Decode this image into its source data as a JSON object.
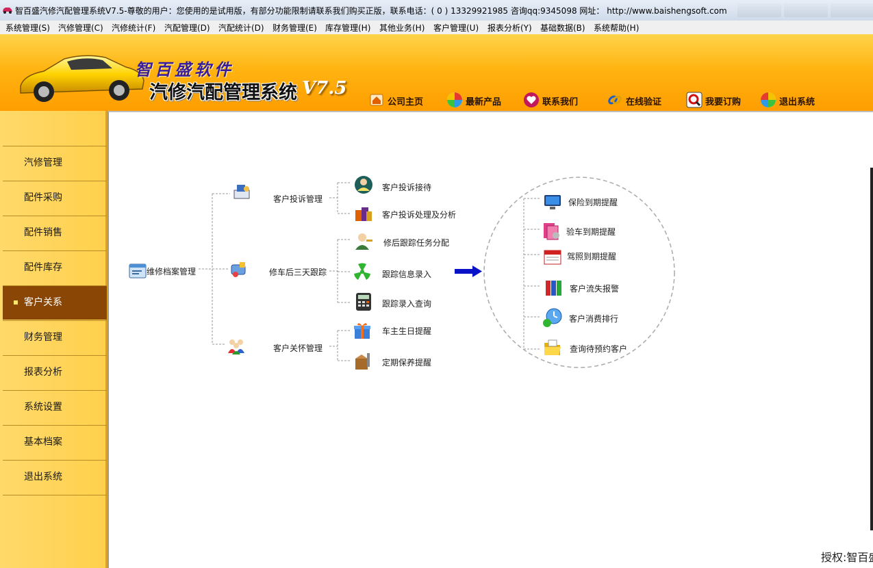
{
  "window": {
    "title": "智百盛汽修汽配管理系统V7.5-尊敬的用户：您使用的是试用版，有部分功能限制请联系我们购买正版，联系电话：( 0 ) 13329921985  咨询qq:9345098   网址： http://www.baishengsoft.com"
  },
  "menu": [
    "系统管理(S)",
    "汽修管理(C)",
    "汽修统计(F)",
    "汽配管理(D)",
    "汽配统计(D)",
    "财务管理(E)",
    "库存管理(H)",
    "其他业务(H)",
    "客户管理(U)",
    "报表分析(Y)",
    "基础数据(B)",
    "系统帮助(H)"
  ],
  "banner": {
    "brand": "智百盛软件",
    "system_name": "汽修汽配管理系统",
    "version": "V7.5",
    "nav": [
      {
        "label": "公司主页",
        "icon": "house-icon"
      },
      {
        "label": "最新产品",
        "icon": "pinwheel-icon"
      },
      {
        "label": "联系我们",
        "icon": "heart-icon"
      },
      {
        "label": "在线验证",
        "icon": "link-icon"
      },
      {
        "label": "我要订购",
        "icon": "magnifier-icon"
      },
      {
        "label": "退出系统",
        "icon": "exit-pinwheel-icon"
      }
    ]
  },
  "sidebar": {
    "items": [
      "汽修管理",
      "配件采购",
      "配件销售",
      "配件库存",
      "客户关系",
      "财务管理",
      "报表分析",
      "系统设置",
      "基本档案",
      "退出系统"
    ],
    "active": "客户关系"
  },
  "tree": {
    "root": {
      "label": "维修档案管理",
      "icon": "archive-window-icon"
    },
    "groups": [
      {
        "label": "客户投诉管理",
        "icon": "complaint-desk-icon",
        "children": [
          {
            "label": "客户投诉接待",
            "icon": "reception-person-icon"
          },
          {
            "label": "客户投诉处理及分析",
            "icon": "gift-bags-icon"
          }
        ]
      },
      {
        "label": "修车后三天跟踪",
        "icon": "tracking-tools-icon",
        "children": [
          {
            "label": "修后跟踪任务分配",
            "icon": "person-key-icon"
          },
          {
            "label": "跟踪信息录入",
            "icon": "radiation-icon"
          },
          {
            "label": "跟踪录入查询",
            "icon": "calculator-icon"
          }
        ]
      },
      {
        "label": "客户关怀管理",
        "icon": "people-group-icon",
        "children": [
          {
            "label": "车主生日提醒",
            "icon": "gift-box-icon"
          },
          {
            "label": "定期保养提醒",
            "icon": "maintenance-box-icon"
          }
        ]
      }
    ],
    "reminders": [
      {
        "label": "保险到期提醒",
        "icon": "monitor-icon"
      },
      {
        "label": "验车到期提醒",
        "icon": "pink-folder-icon"
      },
      {
        "label": "驾照到期提醒",
        "icon": "calendar-icon"
      },
      {
        "label": "客户流失报警",
        "icon": "binders-icon"
      },
      {
        "label": "客户消费排行",
        "icon": "clock-money-icon"
      },
      {
        "label": "查询待预约客户",
        "icon": "open-folder-icon"
      }
    ]
  },
  "colors": {
    "accent_orange": "#ffa400",
    "sidebar_active": "#8a4604",
    "arrow_blue": "#0a12c8"
  },
  "footer": {
    "text": "授权:智百盛"
  }
}
